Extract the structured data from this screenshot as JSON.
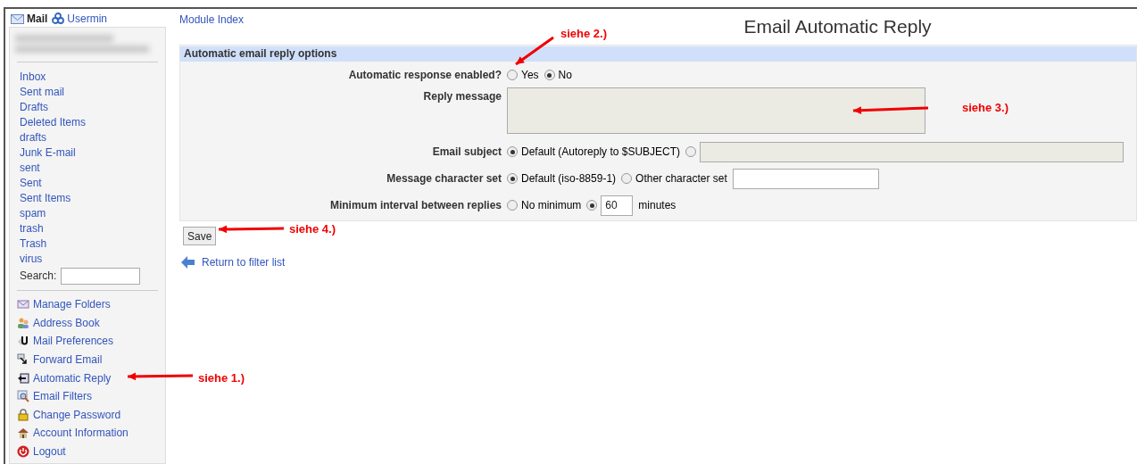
{
  "sidebar": {
    "app": "Mail",
    "usermin": "Usermin",
    "folders": [
      "Inbox",
      "Sent mail",
      "Drafts",
      "Deleted Items",
      "drafts",
      "Junk E-mail",
      "sent",
      "Sent",
      "Sent Items",
      "spam",
      "trash",
      "Trash",
      "virus"
    ],
    "search_label": "Search:",
    "links": [
      {
        "kind": "folders",
        "label": "Manage Folders"
      },
      {
        "kind": "address",
        "label": "Address Book"
      },
      {
        "kind": "prefs",
        "label": "Mail Preferences"
      },
      {
        "kind": "forward",
        "label": "Forward Email"
      },
      {
        "kind": "reply",
        "label": "Automatic Reply"
      },
      {
        "kind": "filters",
        "label": "Email Filters"
      },
      {
        "kind": "password",
        "label": "Change Password"
      },
      {
        "kind": "account",
        "label": "Account Information"
      },
      {
        "kind": "logout",
        "label": "Logout"
      }
    ]
  },
  "module_index": "Module Index",
  "title": "Email Automatic Reply",
  "form": {
    "header": "Automatic email reply options",
    "rows": [
      {
        "kind": "radio",
        "label": "Automatic response enabled?",
        "options": [
          {
            "label": "Yes",
            "selected": false
          },
          {
            "label": "No",
            "selected": true
          }
        ]
      },
      {
        "kind": "textarea",
        "label": "Reply message"
      },
      {
        "kind": "radio",
        "label": "Email subject",
        "options": [
          {
            "label": "Default (Autoreply to $SUBJECT)",
            "selected": true
          },
          {
            "selected": false,
            "field": {
              "kind": "wide",
              "disabled": true
            }
          }
        ]
      },
      {
        "kind": "radio",
        "label": "Message character set",
        "options": [
          {
            "label": "Default (iso-8859-1)",
            "selected": true
          },
          {
            "label": "Other character set",
            "selected": false,
            "field": {
              "kind": "text",
              "disabled": false
            }
          }
        ]
      },
      {
        "kind": "radio",
        "label": "Minimum interval between replies",
        "options": [
          {
            "label": "No minimum",
            "selected": false
          },
          {
            "selected": true,
            "field": {
              "kind": "number",
              "value": "60",
              "disabled": false
            },
            "suffix": "minutes"
          }
        ]
      }
    ]
  },
  "save": "Save",
  "return_link": "Return to filter list",
  "annotations": [
    "siehe 1.)",
    "siehe 2.)",
    "siehe 3.)",
    "siehe 4.)"
  ]
}
